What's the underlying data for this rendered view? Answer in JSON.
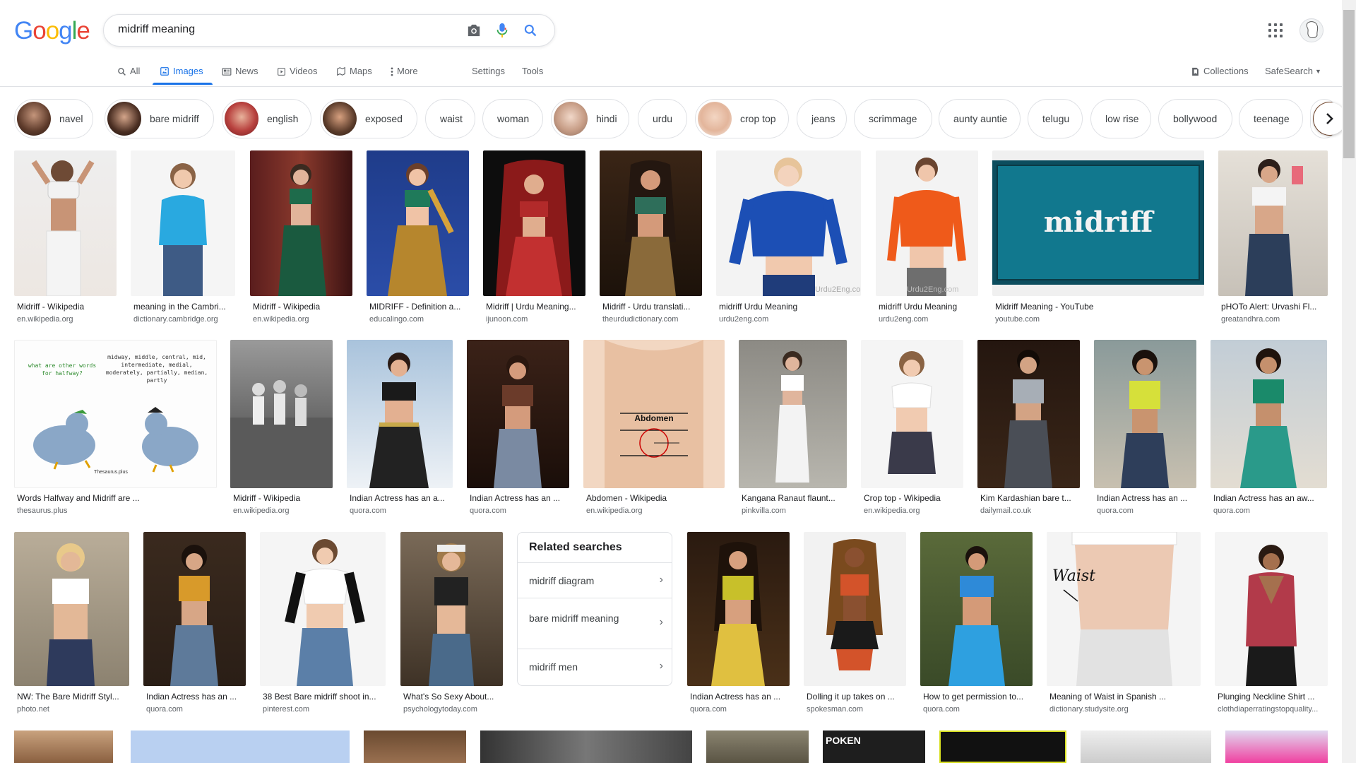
{
  "logo": {
    "letters": [
      "G",
      "o",
      "o",
      "g",
      "l",
      "e"
    ],
    "colors": [
      "#4285f4",
      "#ea4335",
      "#fbbc05",
      "#4285f4",
      "#34a853",
      "#ea4335"
    ]
  },
  "search": {
    "query": "midriff meaning"
  },
  "tabs": {
    "all": "All",
    "images": "Images",
    "news": "News",
    "videos": "Videos",
    "maps": "Maps",
    "more": "More",
    "settings": "Settings",
    "tools": "Tools"
  },
  "right_tools": {
    "collections": "Collections",
    "safesearch": "SafeSearch"
  },
  "chips": [
    "navel",
    "bare midriff",
    "english",
    "exposed",
    "waist",
    "woman",
    "hindi",
    "urdu",
    "crop top",
    "jeans",
    "scrimmage",
    "aunty auntie",
    "telugu",
    "low rise",
    "bollywood",
    "teenage"
  ],
  "results_row1": [
    {
      "title": "Midriff - Wikipedia",
      "source": "en.wikipedia.org"
    },
    {
      "title": "meaning in the Cambri...",
      "source": "dictionary.cambridge.org"
    },
    {
      "title": "Midriff - Wikipedia",
      "source": "en.wikipedia.org"
    },
    {
      "title": "MIDRIFF - Definition a...",
      "source": "educalingo.com"
    },
    {
      "title": "Midriff | Urdu Meaning...",
      "source": "ijunoon.com"
    },
    {
      "title": "Midriff - Urdu translati...",
      "source": "theurdudictionary.com"
    },
    {
      "title": "midriff Urdu Meaning",
      "source": "urdu2eng.com"
    },
    {
      "title": "midriff Urdu Meaning",
      "source": "urdu2eng.com"
    },
    {
      "title": "Midriff Meaning - YouTube",
      "source": "youtube.com"
    },
    {
      "title": "pHOTo Alert: Urvashi Fl...",
      "source": "greatandhra.com"
    }
  ],
  "results_row2": [
    {
      "title": "Words Halfway and Midriff are ...",
      "source": "thesaurus.plus"
    },
    {
      "title": "Midriff - Wikipedia",
      "source": "en.wikipedia.org"
    },
    {
      "title": "Indian Actress has an a...",
      "source": "quora.com"
    },
    {
      "title": "Indian Actress has an ...",
      "source": "quora.com"
    },
    {
      "title": "Abdomen - Wikipedia",
      "source": "en.wikipedia.org"
    },
    {
      "title": "Kangana Ranaut flaunt...",
      "source": "pinkvilla.com"
    },
    {
      "title": "Crop top - Wikipedia",
      "source": "en.wikipedia.org"
    },
    {
      "title": "Kim Kardashian bare t...",
      "source": "dailymail.co.uk"
    },
    {
      "title": "Indian Actress has an ...",
      "source": "quora.com"
    },
    {
      "title": "Indian Actress has an aw...",
      "source": "quora.com"
    }
  ],
  "results_row3": [
    {
      "title": "NW: The Bare Midriff Styl...",
      "source": "photo.net"
    },
    {
      "title": "Indian Actress has an ...",
      "source": "quora.com"
    },
    {
      "title": "38 Best Bare midriff shoot in...",
      "source": "pinterest.com"
    },
    {
      "title": "What's So Sexy About...",
      "source": "psychologytoday.com"
    },
    {
      "title": "Indian Actress has an ...",
      "source": "quora.com"
    },
    {
      "title": "Dolling it up takes on ...",
      "source": "spokesman.com"
    },
    {
      "title": "How to get permission to...",
      "source": "quora.com"
    },
    {
      "title": "Meaning of Waist in Spanish ...",
      "source": "dictionary.studysite.org"
    },
    {
      "title": "Plunging Neckline Shirt ...",
      "source": "clothdiaperratingstopquality..."
    }
  ],
  "related": {
    "title": "Related searches",
    "items": [
      "midriff diagram",
      "bare midriff meaning",
      "midriff men"
    ]
  },
  "image_text": {
    "youtube_word": "midriff",
    "thesaurus_q": "what are other words for halfway?",
    "thesaurus_a": "midway, middle, central, mid, intermediate, medial, moderately, partially, median, partly",
    "thesaurus_brand": "Thesaurus.plus",
    "abdomen_label": "Abdomen",
    "watermark": "Urdu2Eng.com",
    "waist_label": "Waist",
    "poken": "POKEN"
  },
  "colors": {
    "accent": "#1a73e8",
    "muted": "#5f6368",
    "border": "#dfe1e5"
  }
}
